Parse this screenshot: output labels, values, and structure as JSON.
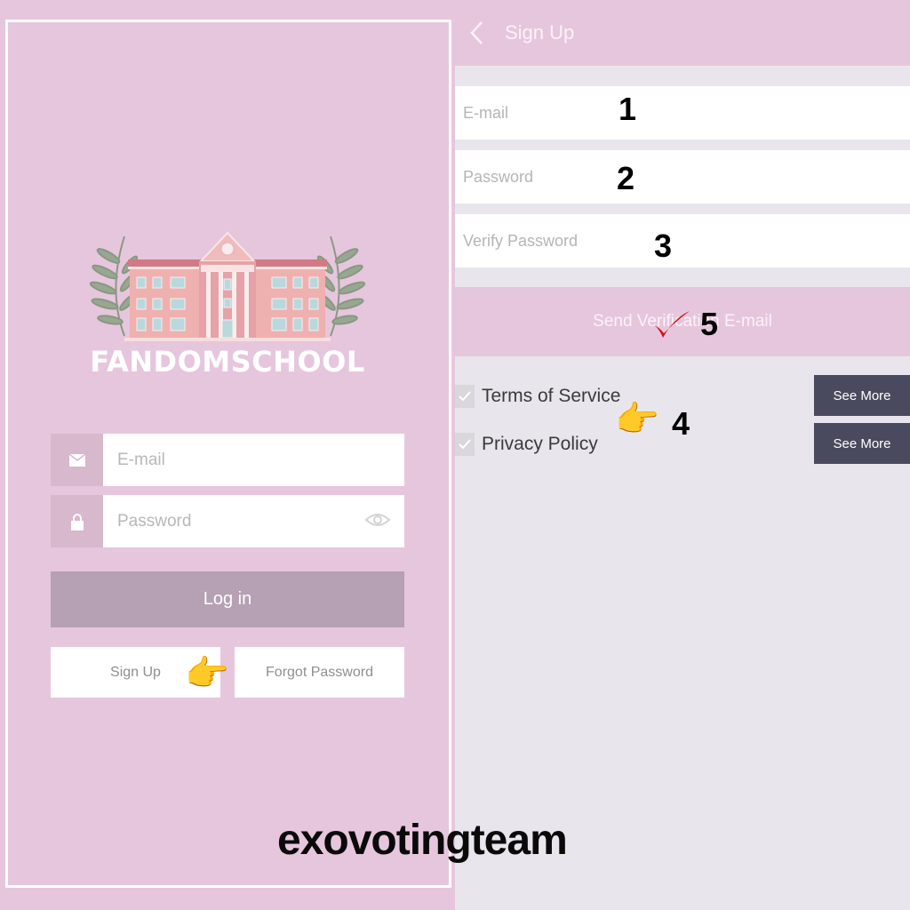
{
  "login_screen": {
    "brand_name": "FANDOMSCHOOL",
    "email_placeholder": "E-mail",
    "password_placeholder": "Password",
    "email_icon": "envelope-icon",
    "password_icon": "lock-icon",
    "password_toggle_icon": "eye-icon",
    "login_label": "Log in",
    "signup_label": "Sign Up",
    "forgot_label": "Forgot Password",
    "pointer_emoji": "👉"
  },
  "signup_screen": {
    "title": "Sign Up",
    "back_icon": "chevron-left-icon",
    "fields": [
      {
        "placeholder": "E-mail",
        "step": "1"
      },
      {
        "placeholder": "Password",
        "step": "2"
      },
      {
        "placeholder": "Verify Password",
        "step": "3"
      }
    ],
    "send_button_label": "Send Verification E-mail",
    "send_step": "5",
    "agreements": [
      {
        "label": "Terms of Service",
        "checked": true,
        "action_label": "See More"
      },
      {
        "label": "Privacy Policy",
        "checked": true,
        "action_label": "See More"
      }
    ],
    "agreements_step": "4",
    "pointer_emoji": "👉"
  },
  "watermark": "exovotingteam",
  "colors": {
    "pink_bg": "#e6c6dd",
    "icon_box": "#d7b8cd",
    "login_button": "#b6a0b4",
    "see_more_button": "#4a4a5e",
    "right_bg": "#e8e6ec",
    "check_mark_red": "#d0121b"
  }
}
